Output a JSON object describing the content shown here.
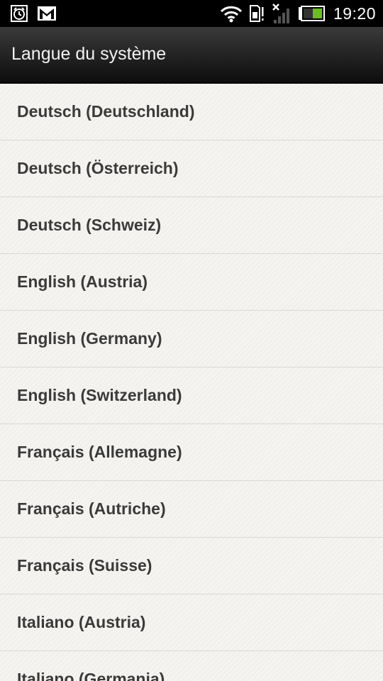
{
  "status_bar": {
    "time": "19:20",
    "icons": [
      "alarm-icon",
      "gmail-icon",
      "wifi-icon",
      "sd-card-icon",
      "signal-icon",
      "battery-icon"
    ]
  },
  "header": {
    "title": "Langue du système"
  },
  "languages": [
    "Deutsch (Deutschland)",
    "Deutsch (Österreich)",
    "Deutsch (Schweiz)",
    "English (Austria)",
    "English (Germany)",
    "English (Switzerland)",
    "Français (Allemagne)",
    "Français (Autriche)",
    "Français (Suisse)",
    "Italiano (Austria)",
    "Italiano (Germania)"
  ],
  "colors": {
    "status_bar_bg": "#000000",
    "title_bar_bg": "#262626",
    "list_bg": "#f5f4f1",
    "item_text": "#3a3a3a",
    "divider": "#d9d8d4",
    "battery_fill": "#6abf1e"
  }
}
